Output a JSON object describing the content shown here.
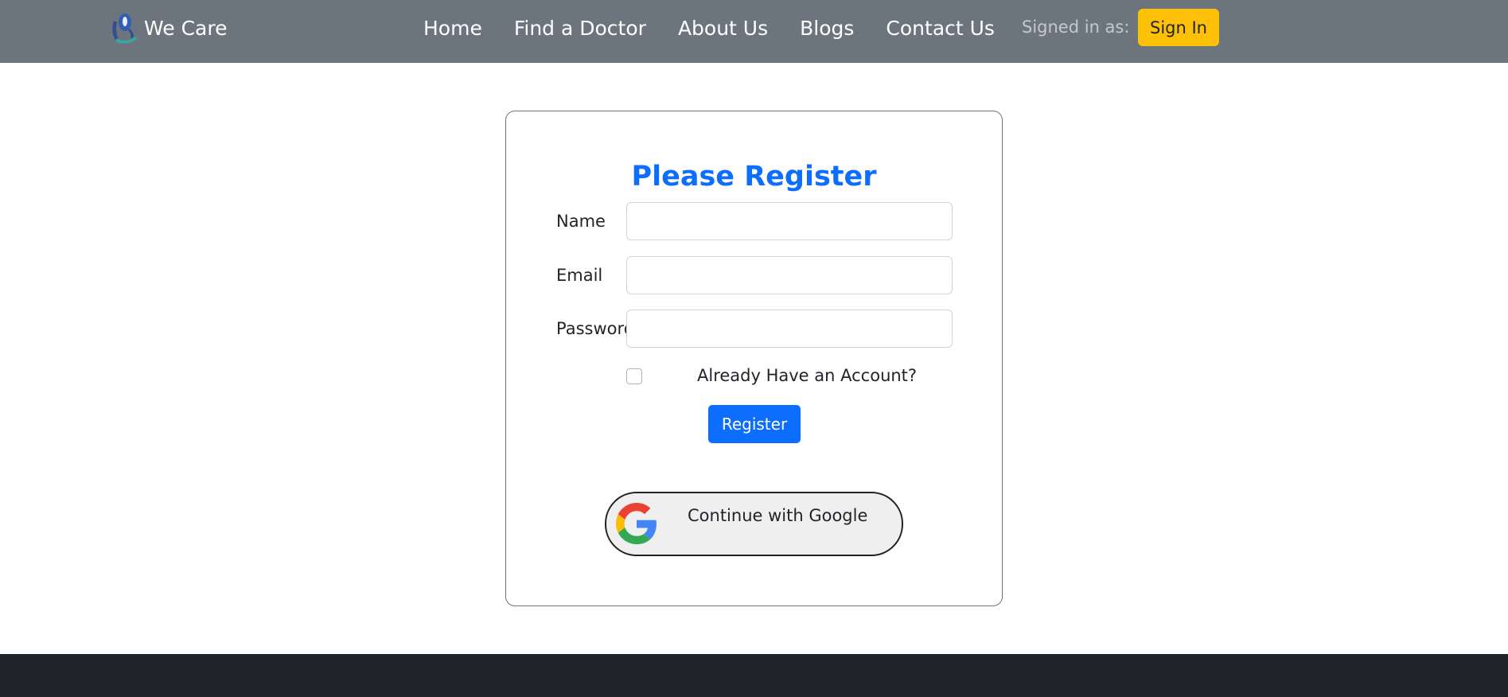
{
  "navbar": {
    "brand_name": "We Care",
    "logo_icon": "we-care-logo",
    "links": [
      "Home",
      "Find a Doctor",
      "About Us",
      "Blogs",
      "Contact Us"
    ],
    "signed_in_label": "Signed in as:",
    "sign_in_button": "Sign In"
  },
  "form": {
    "title": "Please Register",
    "name_label": "Name",
    "name_value": "",
    "email_label": "Email",
    "email_value": "",
    "password_label": "Password",
    "password_value": "",
    "already_account_label": "Already Have an Account?",
    "already_account_checked": false,
    "register_button": "Register",
    "google_button": "Continue with Google",
    "google_icon": "google-g-icon"
  },
  "colors": {
    "navbar_bg": "#6c757d",
    "primary": "#0d6efd",
    "warning": "#ffc107",
    "footer_bg": "#212529"
  }
}
